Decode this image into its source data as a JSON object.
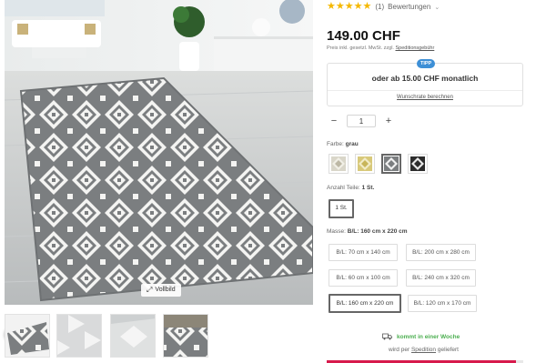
{
  "gallery": {
    "fullview_label": "Vollbild",
    "thumbnails": [
      {
        "name": "thumb-1"
      },
      {
        "name": "thumb-2"
      },
      {
        "name": "thumb-3"
      },
      {
        "name": "thumb-4"
      }
    ],
    "prev_icon": "chevron-left-icon"
  },
  "rating": {
    "stars": 5,
    "count_label": "(1)",
    "reviews_label": "Bewertungen"
  },
  "price": {
    "value": "149.00 CHF",
    "note_prefix": "Preis inkl. gesetzl. MwSt. zzgl.",
    "note_link": "Speditionsgebühr"
  },
  "finance": {
    "badge": "TIPP",
    "text": "oder ab 15.00 CHF monatlich",
    "link": "Wunschrate berechnen"
  },
  "quantity": {
    "minus": "−",
    "value": "1",
    "plus": "+"
  },
  "color": {
    "label": "Farbe:",
    "selected": "grau",
    "swatches": [
      "beige",
      "gelb",
      "grau",
      "schwarz"
    ],
    "selected_index": 2
  },
  "parts": {
    "label": "Anzahl Teile:",
    "selected": "1 St.",
    "options": [
      "1 St."
    ]
  },
  "size": {
    "label": "Masse:",
    "selected": "B/L: 160 cm x 220 cm",
    "options": [
      "B/L: 70 cm x 140 cm",
      "B/L: 200 cm x 280 cm",
      "B/L: 60 cm x 100 cm",
      "B/L: 240 cm x 320 cm",
      "B/L: 160 cm x 220 cm",
      "B/L: 120 cm x 170 cm"
    ]
  },
  "delivery": {
    "text": "kommt in einer Woche",
    "shipper_prefix": "wird per",
    "shipper_link": "Spedition",
    "shipper_suffix": "geliefert"
  },
  "colors": {
    "star": "#f5b800",
    "tip_badge": "#3d8fd6",
    "delivery_green": "#4caf50",
    "cart_red": "#d71a4c"
  }
}
